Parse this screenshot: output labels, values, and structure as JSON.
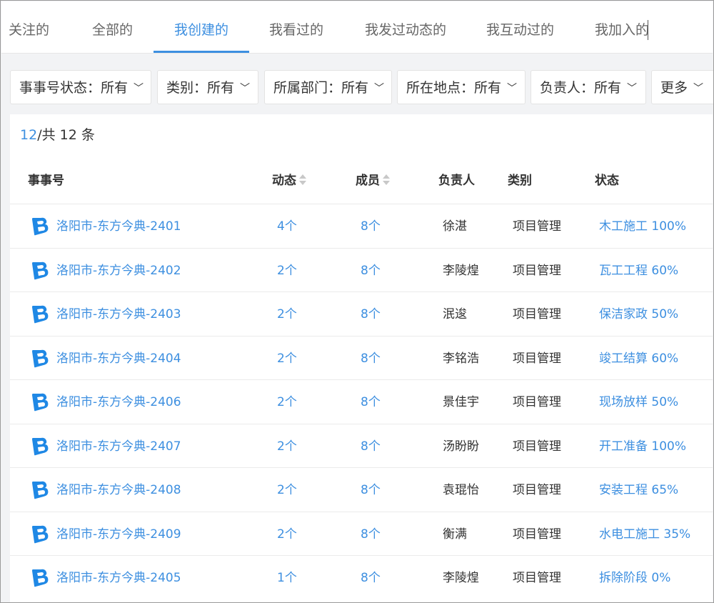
{
  "tabs": [
    "关注的",
    "全部的",
    "我创建的",
    "我看过的",
    "我发过动态的",
    "我互动过的",
    "我加入的"
  ],
  "active_tab": "我创建的",
  "filters": [
    {
      "label": "事事号状态：",
      "value": "所有"
    },
    {
      "label": "类别：",
      "value": "所有"
    },
    {
      "label": "所属部门：",
      "value": "所有"
    },
    {
      "label": "所在地点：",
      "value": "所有"
    },
    {
      "label": "负责人：",
      "value": "所有"
    },
    {
      "label": "更多",
      "value": ""
    }
  ],
  "count": {
    "current": "12",
    "total_text": "/共 12 条"
  },
  "columns": {
    "name": "事事号",
    "posts": "动态",
    "members": "成员",
    "owner": "负责人",
    "category": "类别",
    "status": "状态"
  },
  "rows": [
    {
      "name": "洛阳市-东方今典-2401",
      "posts": "4个",
      "members": "8个",
      "owner": "徐湛",
      "category": "项目管理",
      "status": "木工施工 100%"
    },
    {
      "name": "洛阳市-东方今典-2402",
      "posts": "2个",
      "members": "8个",
      "owner": "李陵煌",
      "category": "项目管理",
      "status": "瓦工工程 60%"
    },
    {
      "name": "洛阳市-东方今典-2403",
      "posts": "2个",
      "members": "8个",
      "owner": "泯逡",
      "category": "项目管理",
      "status": "保洁家政 50%"
    },
    {
      "name": "洛阳市-东方今典-2404",
      "posts": "2个",
      "members": "8个",
      "owner": "李铭浩",
      "category": "项目管理",
      "status": "竣工结算 60%"
    },
    {
      "name": "洛阳市-东方今典-2406",
      "posts": "2个",
      "members": "8个",
      "owner": "景佳宇",
      "category": "项目管理",
      "status": "现场放样 50%"
    },
    {
      "name": "洛阳市-东方今典-2407",
      "posts": "2个",
      "members": "8个",
      "owner": "汤盼盼",
      "category": "项目管理",
      "status": "开工准备 100%"
    },
    {
      "name": "洛阳市-东方今典-2408",
      "posts": "2个",
      "members": "8个",
      "owner": "袁琨怡",
      "category": "项目管理",
      "status": "安装工程 65%"
    },
    {
      "name": "洛阳市-东方今典-2409",
      "posts": "2个",
      "members": "8个",
      "owner": "衡满",
      "category": "项目管理",
      "status": "水电工施工 35%"
    },
    {
      "name": "洛阳市-东方今典-2405",
      "posts": "1个",
      "members": "8个",
      "owner": "李陵煌",
      "category": "项目管理",
      "status": "拆除阶段 0%"
    }
  ],
  "colors": {
    "accent": "#3d8fe0",
    "logo": "#1f88e5"
  },
  "icons": {
    "row_logo": "b-logo-icon",
    "dropdown": "chevron-down-icon",
    "sort": "sort-icon"
  }
}
